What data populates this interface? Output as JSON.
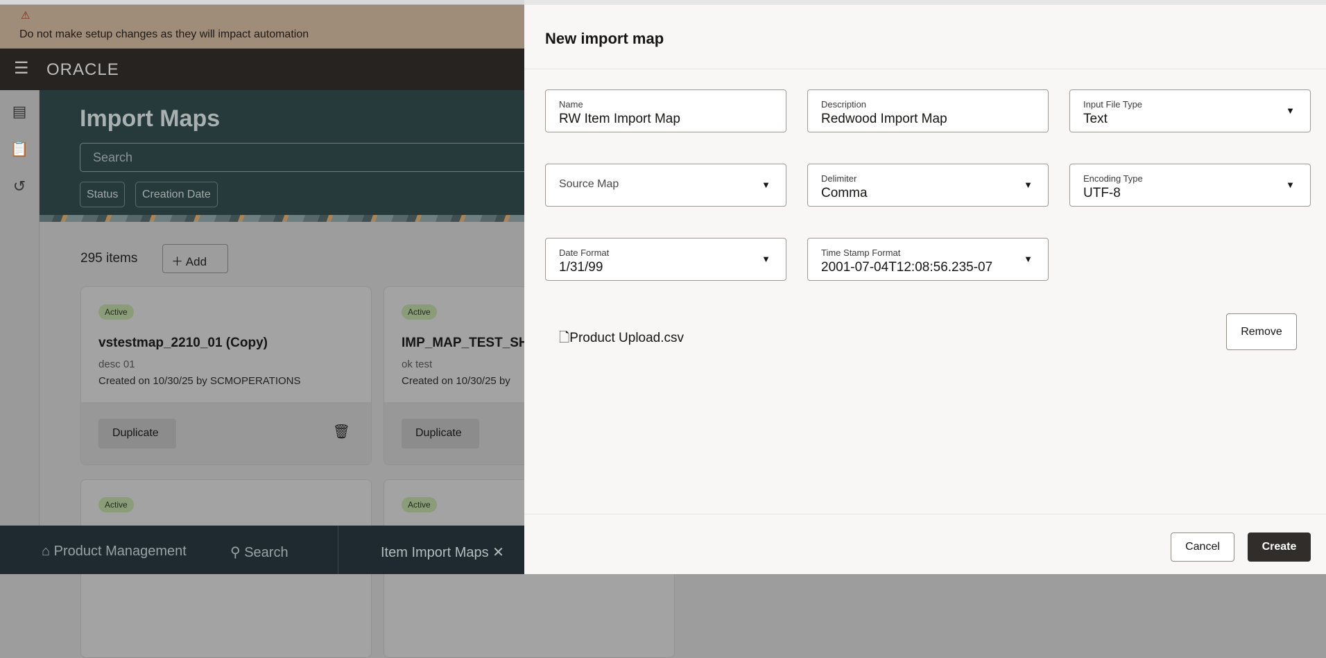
{
  "banner": {
    "icon": "warning-icon",
    "message": "Do not make setup changes as they will impact automation"
  },
  "nav": {
    "logo": "ORACLE",
    "menu_icon": "hamburger-icon"
  },
  "sidebar": {
    "icons": [
      "list-search-icon",
      "clipboard-upload-icon",
      "history-icon"
    ]
  },
  "header": {
    "title": "Import Maps",
    "search_placeholder": "Search",
    "filters": [
      "Status",
      "Creation Date"
    ]
  },
  "list": {
    "count": "295 items",
    "add_label": "Add",
    "cards": [
      {
        "status": "Active",
        "title": "vstestmap_2210_01 (Copy)",
        "desc": "desc 01",
        "created": "Created on 10/30/25 by SCMOPERATIONS",
        "duplicate": "Duplicate"
      },
      {
        "status": "Active",
        "title": "IMP_MAP_TEST_SH",
        "desc": "ok test",
        "created": "Created on 10/30/25 by",
        "duplicate": "Duplicate"
      },
      {
        "status": "Active"
      },
      {
        "status": "Active"
      }
    ]
  },
  "bottom_bar": {
    "home": "Product Management",
    "search": "Search",
    "tab": "Item Import Maps"
  },
  "panel": {
    "title": "New import map",
    "fields": {
      "name": {
        "label": "Name",
        "value": "RW Item Import Map"
      },
      "description": {
        "label": "Description",
        "value": "Redwood Import Map"
      },
      "input_file_type": {
        "label": "Input File Type",
        "value": "Text"
      },
      "source_map": {
        "label": "Source Map"
      },
      "delimiter": {
        "label": "Delimiter",
        "value": "Comma"
      },
      "encoding_type": {
        "label": "Encoding Type",
        "value": "UTF-8"
      },
      "date_format": {
        "label": "Date Format",
        "value": "1/31/99"
      },
      "timestamp_format": {
        "label": "Time Stamp Format",
        "value": "2001-07-04T12:08:56.235-07"
      }
    },
    "file": "Product Upload.csv",
    "remove": "Remove",
    "cancel": "Cancel",
    "create": "Create"
  }
}
